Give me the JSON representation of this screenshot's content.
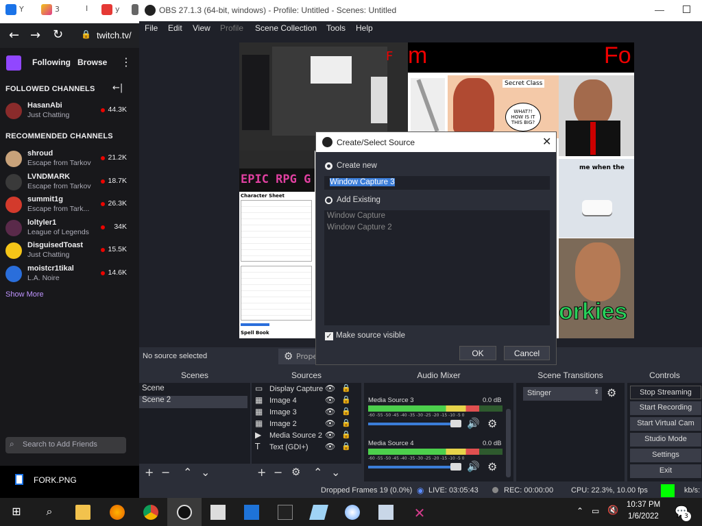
{
  "browser": {
    "address": "twitch.tv/",
    "nav": {
      "following": "Following",
      "browse": "Browse"
    },
    "followed_header": "FOLLOWED CHANNELS",
    "recommended_header": "RECOMMENDED CHANNELS",
    "followed": [
      {
        "name": "HasanAbi",
        "game": "Just Chatting",
        "viewers": "44.3K"
      }
    ],
    "recommended": [
      {
        "name": "shroud",
        "game": "Escape from Tarkov",
        "viewers": "21.2K"
      },
      {
        "name": "LVNDMARK",
        "game": "Escape from Tarkov",
        "viewers": "18.7K"
      },
      {
        "name": "summit1g",
        "game": "Escape from Tark...",
        "viewers": "26.3K"
      },
      {
        "name": "loltyler1",
        "game": "League of Legends",
        "viewers": "34K"
      },
      {
        "name": "DisguisedToast",
        "game": "Just Chatting",
        "viewers": "15.5K"
      },
      {
        "name": "moistcr1tikal",
        "game": "L.A. Noire",
        "viewers": "14.6K"
      }
    ],
    "show_more": "Show More",
    "search_placeholder": "Search to Add Friends",
    "download_file": "FORK.PNG"
  },
  "obs": {
    "title": "OBS 27.1.3 (64-bit, windows) - Profile: Untitled - Scenes: Untitled",
    "menu": [
      "File",
      "Edit",
      "View",
      "Profile",
      "Scene Collection",
      "Tools",
      "Help"
    ],
    "no_source": "No source selected",
    "properties_label": "Prope",
    "docks": {
      "scenes": {
        "title": "Scenes",
        "items": [
          "Scene",
          "Scene 2"
        ]
      },
      "sources": {
        "title": "Sources",
        "items": [
          "Display Capture",
          "Image 4",
          "Image 3",
          "Image 2",
          "Media Source 2",
          "Text (GDI+)"
        ]
      },
      "mixer": {
        "title": "Audio Mixer",
        "channels": [
          {
            "name": "Media Source 3",
            "db": "0.0 dB",
            "level": 0.88
          },
          {
            "name": "Media Source 4",
            "db": "0.0 dB",
            "level": 0.88
          }
        ],
        "scale": "-60 -55 -50 -45 -40 -35 -30 -25 -20 -15 -10 -5 0"
      },
      "transitions": {
        "title": "Scene Transitions",
        "selected": "Stinger"
      },
      "controls": {
        "title": "Controls",
        "buttons": [
          "Stop Streaming",
          "Start Recording",
          "Start Virtual Cam",
          "Studio Mode",
          "Settings",
          "Exit"
        ]
      }
    },
    "status": {
      "dropped": "Dropped Frames 19 (0.0%)",
      "live": "LIVE: 03:05:43",
      "rec": "REC: 00:00:00",
      "cpu": "CPU: 22.3%, 10.00 fps",
      "kbs": "kb/s:"
    },
    "preview_text": {
      "m": "m",
      "fo": "Fo",
      "me_when": "me when the",
      "orkies": "orkies",
      "secret_class": "Secret Class",
      "speech": "WHAT?! HOW IS IT THIS BIG?",
      "epic": "EPIC RPG G",
      "char_sheet": "Character Sheet",
      "spell_book": "Spell Book"
    }
  },
  "dialog": {
    "title": "Create/Select Source",
    "create_new": "Create new",
    "name_value": "Window Capture 3",
    "add_existing": "Add Existing",
    "existing": [
      "Window Capture",
      "Window Capture 2"
    ],
    "make_visible": "Make source visible",
    "ok": "OK",
    "cancel": "Cancel"
  },
  "taskbar": {
    "time": "10:37 PM",
    "date": "1/6/2022",
    "notifications": "3"
  }
}
